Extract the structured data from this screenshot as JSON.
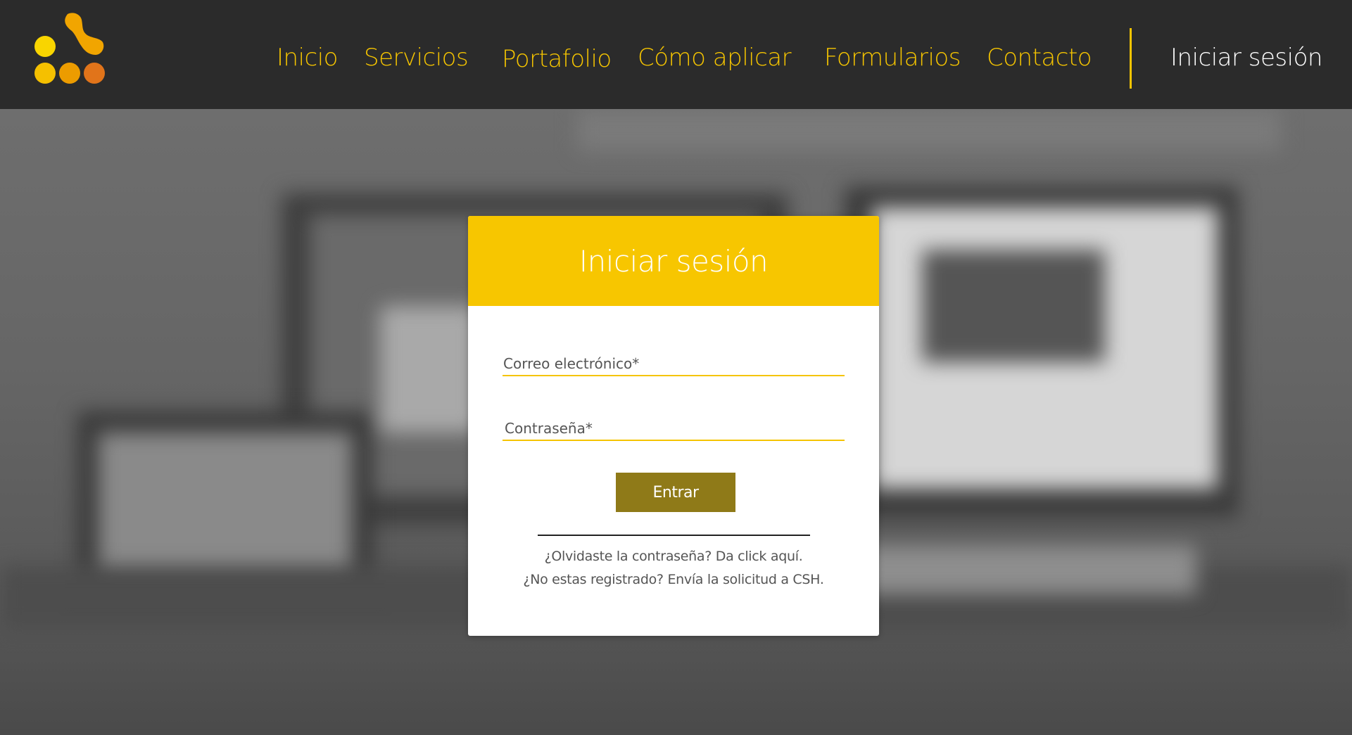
{
  "nav": {
    "items": [
      {
        "label": "Inicio"
      },
      {
        "label": "Servicios"
      },
      {
        "label": "Portafolio"
      },
      {
        "label": "Cómo aplicar"
      },
      {
        "label": "Formularios"
      },
      {
        "label": "Contacto"
      }
    ],
    "login": "Iniciar sesión"
  },
  "colors": {
    "brand_yellow": "#f7c600",
    "button_olive": "#8f7a18",
    "header_dark": "#2b2b2b"
  },
  "card": {
    "title": "Iniciar sesión",
    "email_placeholder": "Correo electrónico*",
    "password_placeholder": "Contraseña*",
    "submit_label": "Entrar",
    "forgot_text": "¿Olvidaste la contraseña? Da click aquí.",
    "register_text": "¿No estas registrado? Envía la solicitud a CSH."
  }
}
